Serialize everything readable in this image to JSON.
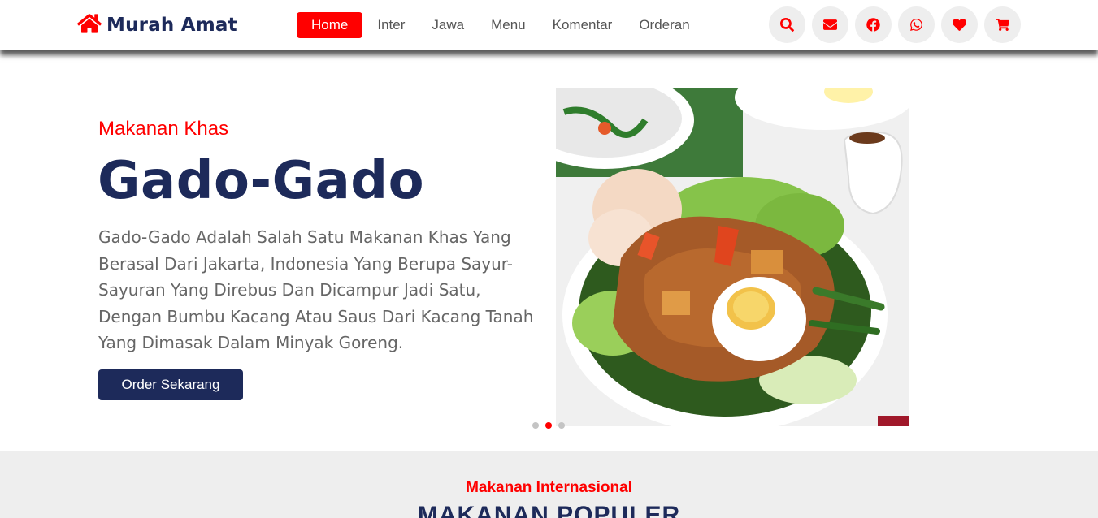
{
  "brand": {
    "name": "Murah Amat",
    "icon": "home-icon",
    "accent_color": "#ff0000",
    "dark_color": "#1d2a5a"
  },
  "nav": {
    "items": [
      {
        "label": "Home",
        "active": true
      },
      {
        "label": "Inter",
        "active": false
      },
      {
        "label": "Jawa",
        "active": false
      },
      {
        "label": "Menu",
        "active": false
      },
      {
        "label": "Komentar",
        "active": false
      },
      {
        "label": "Orderan",
        "active": false
      }
    ]
  },
  "header_icons": [
    "search-icon",
    "envelope-icon",
    "facebook-icon",
    "whatsapp-icon",
    "heart-icon",
    "cart-icon"
  ],
  "hero": {
    "subtitle": "Makanan Khas",
    "title": "Gado-Gado",
    "description": "Gado-Gado Adalah Salah Satu Makanan Khas Yang Berasal Dari Jakarta, Indonesia Yang Berupa Sayur-Sayuran Yang Direbus Dan Dicampur Jadi Satu, Dengan Bumbu Kacang Atau Saus Dari Kacang Tanah Yang Dimasak Dalam Minyak Goreng.",
    "button_label": "Order Sekarang",
    "slide_count": 3,
    "active_slide": 2
  },
  "popular": {
    "subtitle": "Makanan Internasional",
    "title": "MAKANAN POPULER"
  }
}
